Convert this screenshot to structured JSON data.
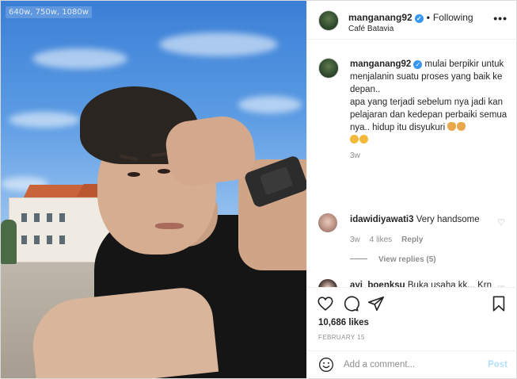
{
  "photo": {
    "size_tag": "640w, 750w, 1080w"
  },
  "header": {
    "username": "manganang92",
    "follow_label": "Following",
    "location": "Café Batavia",
    "more_icon": "more-options-icon"
  },
  "caption": {
    "username": "manganang92",
    "text": "mulai berpikir untuk menjalanin suatu proses yang baik ke depan..\napa yang terjadi sebelum nya jadi kan pelajaran dan kedepan perbaiki semua nya.. hidup itu disyukuri",
    "time": "3w"
  },
  "comments": [
    {
      "username": "idawidiyawati3",
      "text": "Very handsome",
      "time": "3w",
      "likes": "4 likes",
      "reply_label": "Reply",
      "view_replies": "View replies (5)"
    },
    {
      "username": "ayi_boenksu",
      "text": "Buka usaha kk... Krn klo sdh pensiun jd tdk trgantung sm gaji pensiun aja..slagi masih muda"
    }
  ],
  "actions": {
    "likes": "10,686 likes",
    "date": "FEBRUARY 15"
  },
  "add_comment": {
    "placeholder": "Add a comment...",
    "post_label": "Post"
  },
  "colors": {
    "verified": "#3897f0",
    "post_disabled": "#b2dffc",
    "muted_text": "#8e8e8e"
  }
}
